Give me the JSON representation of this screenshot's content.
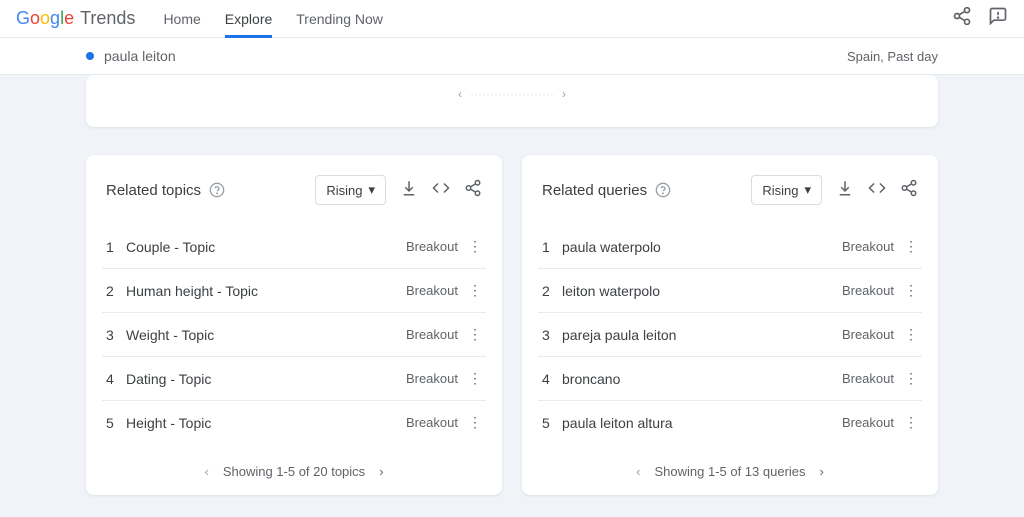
{
  "header": {
    "logo_trends": "Trends",
    "nav": {
      "home": "Home",
      "explore": "Explore",
      "trending": "Trending Now"
    }
  },
  "subheader": {
    "search_term": "paula leiton",
    "breadcrumb": "Spain, Past day"
  },
  "topics_card": {
    "title": "Related topics",
    "dropdown": "Rising",
    "rows": [
      {
        "n": "1",
        "text": "Couple - Topic",
        "badge": "Breakout"
      },
      {
        "n": "2",
        "text": "Human height - Topic",
        "badge": "Breakout"
      },
      {
        "n": "3",
        "text": "Weight - Topic",
        "badge": "Breakout"
      },
      {
        "n": "4",
        "text": "Dating - Topic",
        "badge": "Breakout"
      },
      {
        "n": "5",
        "text": "Height - Topic",
        "badge": "Breakout"
      }
    ],
    "pagination": "Showing 1-5 of 20 topics"
  },
  "queries_card": {
    "title": "Related queries",
    "dropdown": "Rising",
    "rows": [
      {
        "n": "1",
        "text": "paula waterpolo",
        "badge": "Breakout"
      },
      {
        "n": "2",
        "text": "leiton waterpolo",
        "badge": "Breakout"
      },
      {
        "n": "3",
        "text": "pareja paula leiton",
        "badge": "Breakout"
      },
      {
        "n": "4",
        "text": "broncano",
        "badge": "Breakout"
      },
      {
        "n": "5",
        "text": "paula leiton altura",
        "badge": "Breakout"
      }
    ],
    "pagination": "Showing 1-5 of 13 queries"
  }
}
